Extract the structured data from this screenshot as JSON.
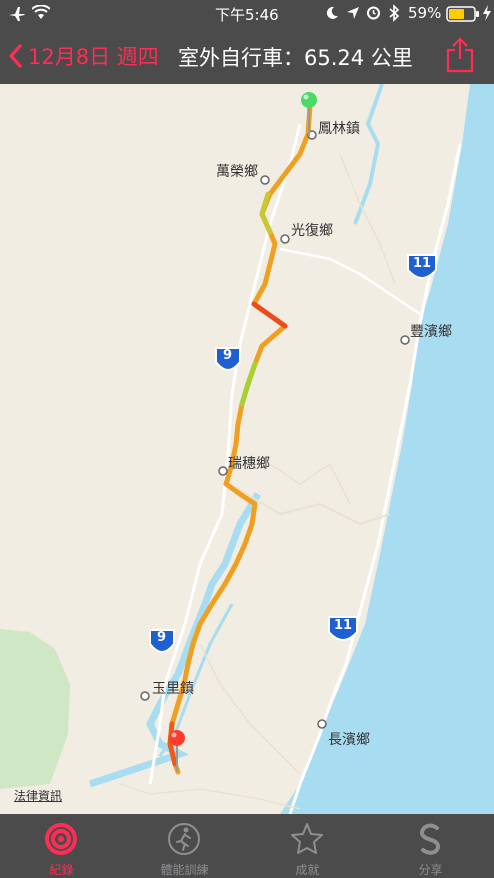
{
  "status": {
    "time": "下午5:46",
    "battery": "59%"
  },
  "nav": {
    "back_label": "12月8日 週四",
    "title": "室外自行車：65.24 公里"
  },
  "map": {
    "places": {
      "fenglin": "鳳林鎮",
      "wanrong": "萬榮鄉",
      "guangfu": "光復鄉",
      "fengbin": "豐濱鄉",
      "ruisui": "瑞穗鄉",
      "yuli": "玉里鎮",
      "changbin": "長濱鄉"
    },
    "route_shields": {
      "r9_a": "9",
      "r9_b": "9",
      "r11_a": "11",
      "r11_b": "11"
    },
    "legal": "法律資訊"
  },
  "tabs": [
    {
      "label": "紀錄",
      "icon": "activity-rings-icon",
      "active": true
    },
    {
      "label": "體能訓練",
      "icon": "running-figure-icon",
      "active": false
    },
    {
      "label": "成就",
      "icon": "star-badge-icon",
      "active": false
    },
    {
      "label": "分享",
      "icon": "share-s-icon",
      "active": false
    }
  ],
  "colors": {
    "accent": "#ff2d55",
    "bar": "#4b4b4b",
    "sea": "#a8dcf0",
    "land": "#f1ede3",
    "route": "#f0a020"
  }
}
